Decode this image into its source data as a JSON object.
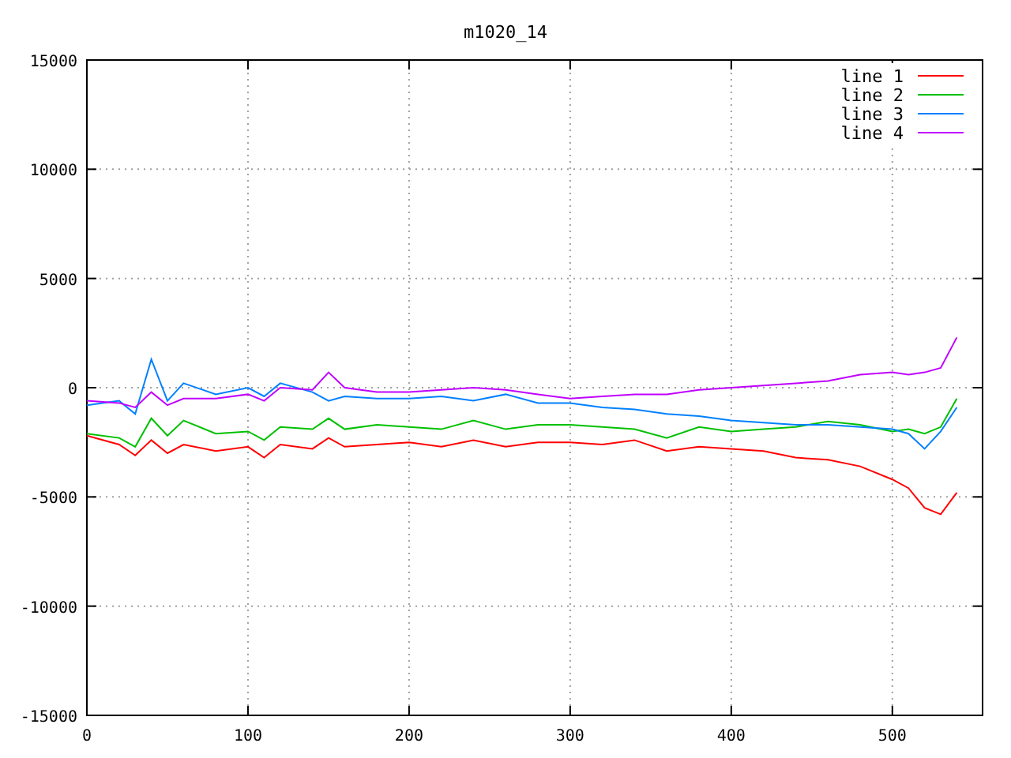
{
  "chart": {
    "chart_data": {
      "type": "line",
      "title": "m1020_14",
      "x": [
        0,
        20,
        30,
        40,
        50,
        60,
        80,
        100,
        110,
        120,
        140,
        150,
        160,
        180,
        200,
        220,
        240,
        260,
        280,
        300,
        320,
        340,
        360,
        380,
        400,
        420,
        440,
        460,
        480,
        500,
        510,
        520,
        530,
        540
      ],
      "series": [
        {
          "name": "line 1",
          "color": "#ff0000",
          "values": [
            -2200,
            -2600,
            -3100,
            -2400,
            -3000,
            -2600,
            -2900,
            -2700,
            -3200,
            -2600,
            -2800,
            -2300,
            -2700,
            -2600,
            -2500,
            -2700,
            -2400,
            -2700,
            -2500,
            -2500,
            -2600,
            -2400,
            -2900,
            -2700,
            -2800,
            -2900,
            -3200,
            -3300,
            -3600,
            -4200,
            -4600,
            -5500,
            -5800,
            -4800
          ]
        },
        {
          "name": "line 2",
          "color": "#00c000",
          "values": [
            -2100,
            -2300,
            -2700,
            -1400,
            -2200,
            -1500,
            -2100,
            -2000,
            -2400,
            -1800,
            -1900,
            -1400,
            -1900,
            -1700,
            -1800,
            -1900,
            -1500,
            -1900,
            -1700,
            -1700,
            -1800,
            -1900,
            -2300,
            -1800,
            -2000,
            -1900,
            -1800,
            -1550,
            -1700,
            -2000,
            -1900,
            -2100,
            -1800,
            -500
          ]
        },
        {
          "name": "line 3",
          "color": "#0080ff",
          "values": [
            -800,
            -600,
            -1200,
            1300,
            -600,
            200,
            -300,
            0,
            -400,
            200,
            -200,
            -600,
            -400,
            -500,
            -500,
            -400,
            -600,
            -300,
            -700,
            -700,
            -900,
            -1000,
            -1200,
            -1300,
            -1500,
            -1600,
            -1700,
            -1700,
            -1800,
            -1900,
            -2100,
            -2800,
            -2000,
            -900
          ]
        },
        {
          "name": "line 4",
          "color": "#c000ff",
          "values": [
            -600,
            -700,
            -900,
            -200,
            -800,
            -500,
            -500,
            -300,
            -600,
            0,
            -100,
            700,
            0,
            -200,
            -200,
            -100,
            0,
            -100,
            -300,
            -500,
            -400,
            -300,
            -300,
            -100,
            0,
            100,
            200,
            300,
            600,
            700,
            600,
            700,
            900,
            2300
          ]
        }
      ],
      "grid": true,
      "legend": true,
      "xlim": [
        0,
        556
      ],
      "ylim": [
        -15000,
        15000
      ],
      "xticks": [
        0,
        100,
        200,
        300,
        400,
        500
      ],
      "yticks": [
        -15000,
        -10000,
        -5000,
        0,
        5000,
        10000,
        15000
      ]
    }
  }
}
